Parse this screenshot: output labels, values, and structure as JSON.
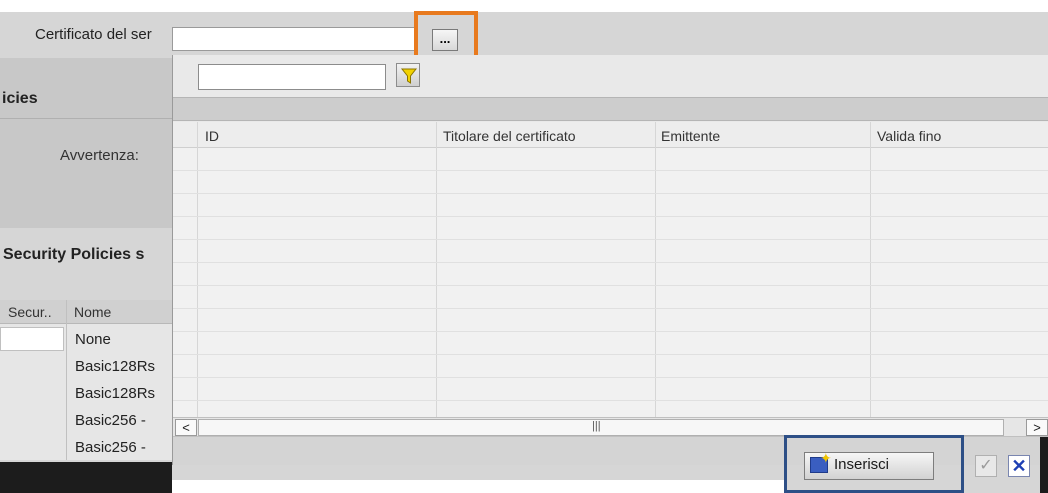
{
  "background_panel": {
    "server_cert_label": "Certificato del ser",
    "browse_button_label": "...",
    "policies_heading": "icies",
    "warning_label": "Avvertenza:",
    "security_policies_heading": "Security Policies s",
    "table": {
      "columns": [
        "Secur..",
        "Nome"
      ],
      "rows": [
        "None",
        "Basic128Rs",
        "Basic128Rs",
        "Basic256 - ",
        "Basic256 - "
      ]
    }
  },
  "popup": {
    "filter_placeholder": "",
    "grid": {
      "columns": [
        "ID",
        "Titolare del certificato",
        "Emittente",
        "Valida fino"
      ],
      "rows": []
    },
    "scroll_left": "<",
    "scroll_right": ">",
    "thumb_grip": "|||",
    "insert_button_label": "Inserisci",
    "confirm_icon": "✓",
    "cancel_icon": "✕"
  },
  "colors": {
    "orange_highlight": "#e87a1e",
    "blue_highlight": "#2d4f86",
    "cancel_blue": "#1e3fb4"
  }
}
